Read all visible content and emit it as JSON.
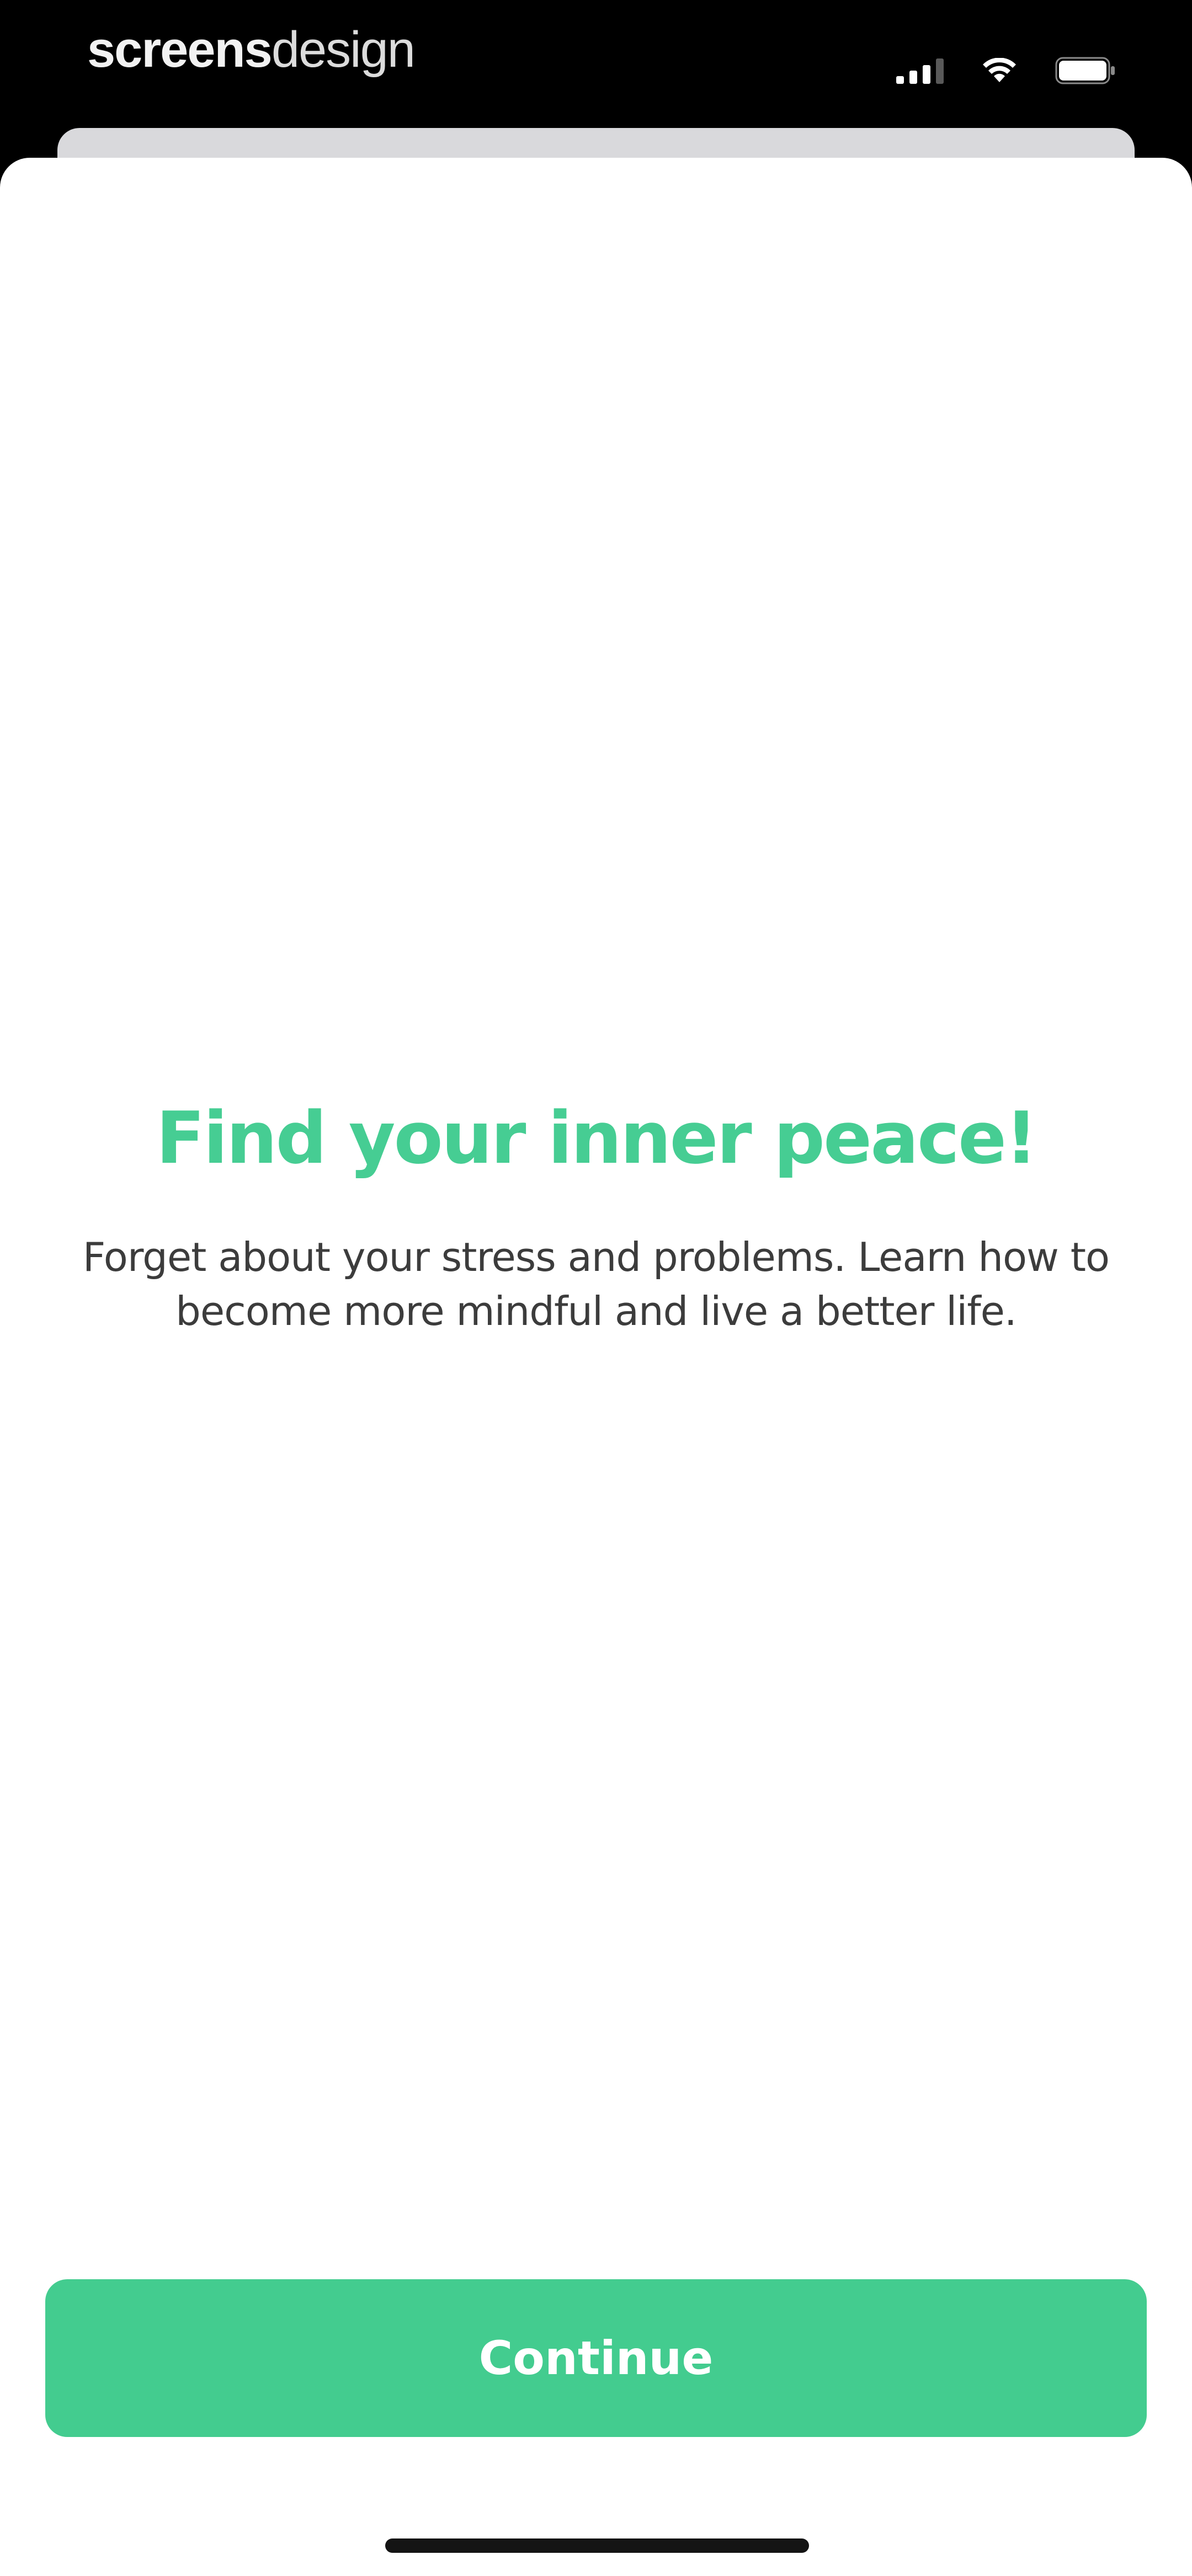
{
  "status_bar": {
    "watermark_bold": "screens",
    "watermark_light": "design",
    "icons": [
      "signal-icon",
      "wifi-icon",
      "battery-icon"
    ]
  },
  "onboarding": {
    "headline": "Find your inner peace!",
    "body": "Forget about your stress and problems. Learn how to become more mindful and live a better life.",
    "continue_label": "Continue"
  },
  "colors": {
    "accent": "#43cc8f",
    "headline": "#46cd93",
    "body_text": "#3c3c3c",
    "background": "#ffffff",
    "status_bar": "#000000"
  }
}
